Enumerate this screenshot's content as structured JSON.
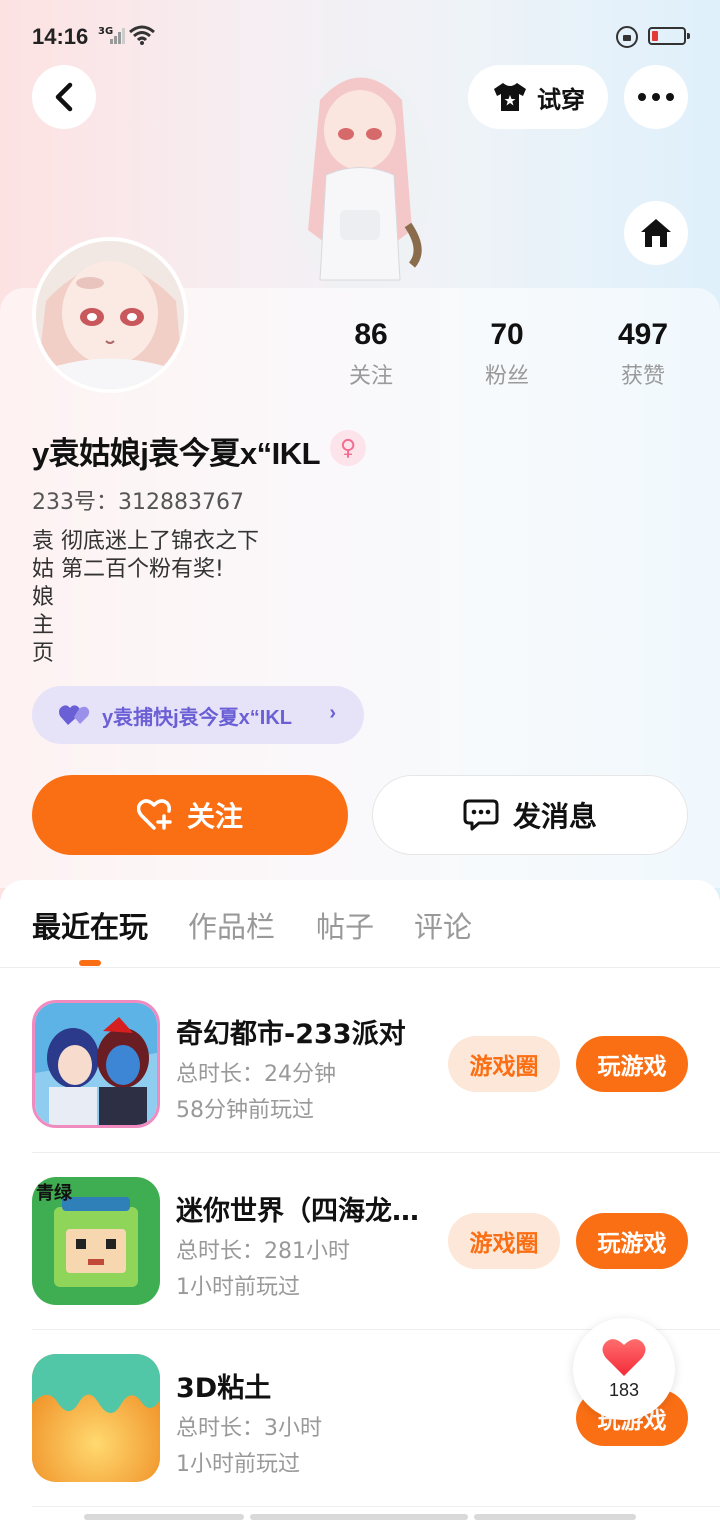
{
  "status_bar": {
    "time": "14:16",
    "network": "3G"
  },
  "header": {
    "tryon_label": "试穿"
  },
  "profile": {
    "stats": [
      {
        "value": "86",
        "label": "关注"
      },
      {
        "value": "70",
        "label": "粉丝"
      },
      {
        "value": "497",
        "label": "获赞"
      }
    ],
    "name": "y袁姑娘j袁今夏x“IKL",
    "gender_symbol": "♀",
    "uid": "233号：312883767",
    "bio": "袁 彻底迷上了锦衣之下\n姑 第二百个粉有奖!\n娘\n主\n页",
    "cp_tag": "y袁捕快j袁今夏x“IKL"
  },
  "actions": {
    "follow_label": "关注",
    "message_label": "发消息"
  },
  "tabs": [
    {
      "label": "最近在玩"
    },
    {
      "label": "作品栏"
    },
    {
      "label": "帖子"
    },
    {
      "label": "评论"
    }
  ],
  "games": [
    {
      "title": "奇幻都市-233派对",
      "duration": "总时长：24分钟",
      "last_played": "58分钟前玩过",
      "circle_label": "游戏圈",
      "play_label": "玩游戏"
    },
    {
      "title": "迷你世界（四海龙…",
      "duration": "总时长：281小时",
      "last_played": "1小时前玩过",
      "circle_label": "游戏圈",
      "play_label": "玩游戏"
    },
    {
      "title": "3D粘土",
      "duration": "总时长：3小时",
      "last_played": "1小时前玩过",
      "play_label": "玩游戏"
    }
  ],
  "like_float": {
    "count": "183"
  },
  "colors": {
    "accent": "#fb6f14",
    "accent_soft": "#fde7d8",
    "cp_purple": "#6b5fd6"
  }
}
